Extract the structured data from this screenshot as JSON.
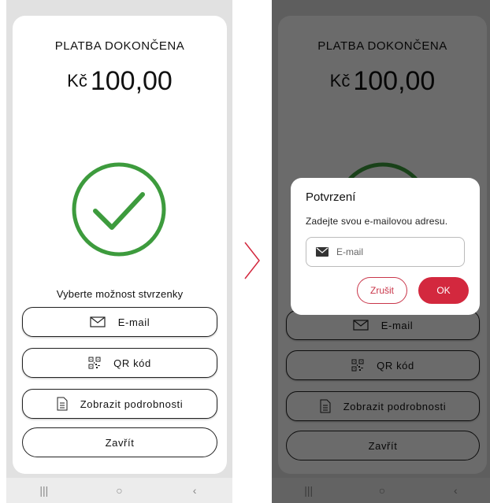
{
  "screen": {
    "title": "PLATBA DOKONČENA",
    "currency": "Kč",
    "amount": "100,00",
    "receipt_label": "Vyberte možnost stvrzenky",
    "buttons": {
      "email": "E-mail",
      "qr": "QR kód",
      "details": "Zobrazit podrobnosti",
      "close": "Zavřít"
    },
    "icons": [
      "mail-icon",
      "qr-code-icon",
      "document-icon",
      "success-check-icon"
    ],
    "accent_color": "#3d9b3d"
  },
  "dialog": {
    "title": "Potvrzení",
    "message": "Zadejte svou e-mailovou adresu.",
    "input_placeholder": "E-mail",
    "cancel_label": "Zrušit",
    "ok_label": "OK",
    "accent_color": "#d3283e"
  },
  "navbar": {
    "recents": "|||",
    "home": "○",
    "back": "‹"
  },
  "transition_icon": "chevron-right-icon"
}
